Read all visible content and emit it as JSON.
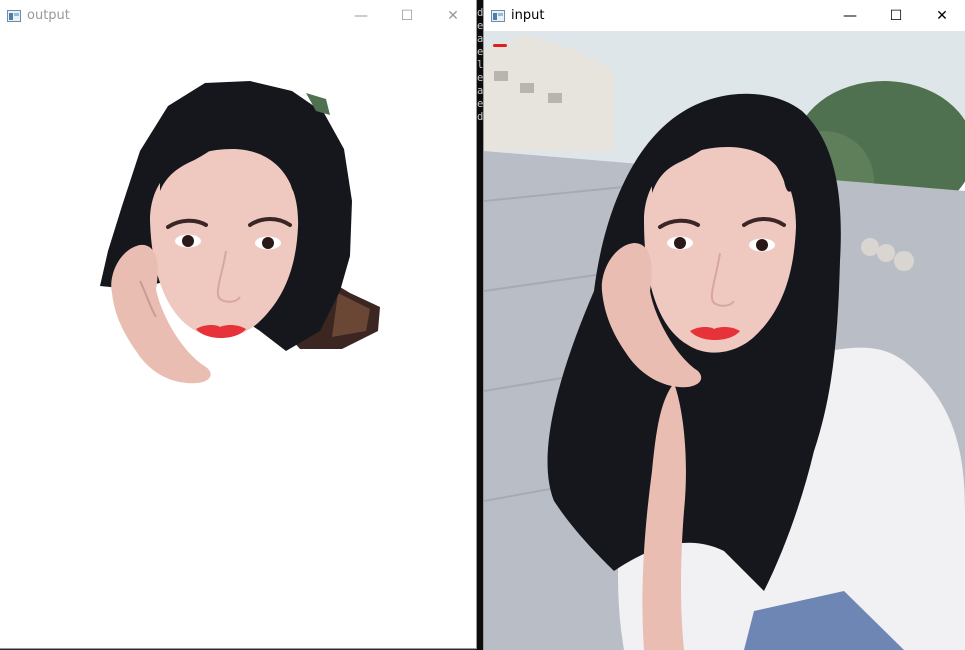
{
  "output_window": {
    "title": "output",
    "controls": {
      "minimize": "—",
      "maximize": "☐",
      "close": "✕"
    }
  },
  "input_window": {
    "title": "input",
    "controls": {
      "minimize": "—",
      "maximize": "☐",
      "close": "✕"
    }
  },
  "console": {
    "chars": [
      "d",
      "e",
      "a",
      "e",
      "l",
      "e",
      "a",
      "e",
      "d"
    ]
  },
  "colors": {
    "hair": "#15171c",
    "skin": "#efc8c0",
    "lips": "#e8323a",
    "shirt": "#f1f0f2",
    "ground": "#b9bec6",
    "sky": "#dfe6ea",
    "tree": "#4f7150"
  }
}
